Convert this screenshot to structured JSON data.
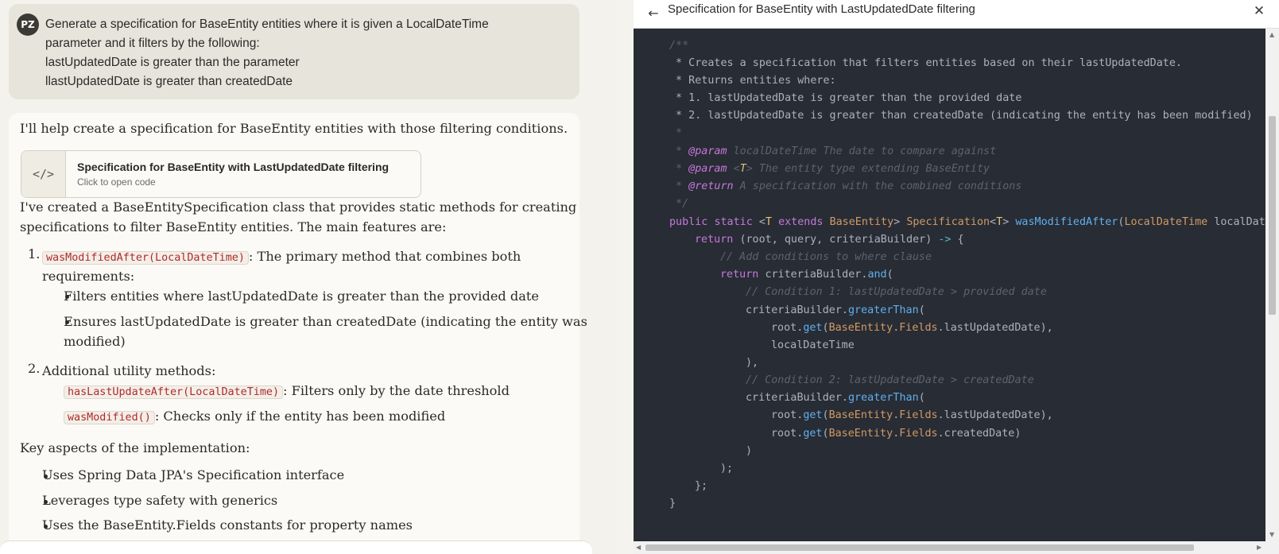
{
  "user_message": {
    "initials": "PZ",
    "lines": [
      "Generate a specification for BaseEntity entities where it is given a LocalDateTime",
      "parameter and it filters by the following:",
      "lastUpdatedDate is greater than the parameter",
      "llastUpdatedDate is greater than createdDate"
    ]
  },
  "assistant": {
    "intro": "I'll help create a specification for BaseEntity entities with those filtering conditions.",
    "artifact": {
      "icon": "</>",
      "title": "Specification for BaseEntity with LastUpdatedDate filtering",
      "subtitle": "Click to open code"
    },
    "para1_line1": "I've created a BaseEntitySpecification class that provides static methods for creating",
    "para1_line2": "specifications to filter BaseEntity entities. The main features are:",
    "item1": {
      "num": "1.",
      "code": "wasModifiedAfter(LocalDateTime)",
      "text1": ": The primary method that combines both",
      "text2": "requirements:",
      "bullets": [
        "Filters entities where lastUpdatedDate is greater than the provided date",
        "Ensures lastUpdatedDate is greater than createdDate (indicating the entity was",
        "modified)"
      ]
    },
    "item2": {
      "num": "2.",
      "text": "Additional utility methods:",
      "b1_code": "hasLastUpdateAfter(LocalDateTime)",
      "b1_text": ": Filters only by the date threshold",
      "b2_code": "wasModified()",
      "b2_text": ": Checks only if the entity has been modified"
    },
    "key_aspects": "Key aspects of the implementation:",
    "aspects": [
      "Uses Spring Data JPA's Specification interface",
      "Leverages type safety with generics",
      "Uses the BaseEntity.Fields constants for property names"
    ]
  },
  "panel": {
    "title": "Specification for BaseEntity with LastUpdatedDate filtering",
    "back_icon": "arrow-left-icon",
    "close_icon": "close-icon"
  },
  "code": {
    "l01": "/**",
    "l02": " * Creates a specification that filters entities based on their lastUpdatedDate.",
    "l03": " * Returns entities where:",
    "l04": " * 1. lastUpdatedDate is greater than the provided date",
    "l05": " * 2. lastUpdatedDate is greater than createdDate (indicating the entity has been modified)",
    "l06": " *",
    "l07a": " * ",
    "l07b": "@param",
    "l07c": " localDateTime The date to compare against",
    "l08a": " * ",
    "l08b": "@param",
    "l08c": " <",
    "l08d": "T",
    "l08e": "> The entity type extending BaseEntity",
    "l09a": " * ",
    "l09b": "@return",
    "l09c": " A specification with the combined conditions",
    "l10": " */",
    "l11_public": "public",
    "l11_static": "static",
    "l11_lt": "<",
    "l11_T": "T",
    "l11_extends": "extends",
    "l11_base": "BaseEntity",
    "l11_gt": ">",
    "l11_spec": "Specification",
    "l11_lt2": "<",
    "l11_T2": "T",
    "l11_gt2": ">",
    "l11_fn": "wasModifiedAfter",
    "l11_paren": "(",
    "l11_ldt": "LocalDateTime",
    "l11_param": "localDateTime",
    "l12_return": "return",
    "l12_args": "(root, query, criteriaBuilder)",
    "l12_arrow": "->",
    "l12_brace": "{",
    "l13": "// Add conditions to where clause",
    "l14_return": "return",
    "l14_cb": "criteriaBuilder.",
    "l14_and": "and",
    "l14_paren": "(",
    "l15": "// Condition 1: lastUpdatedDate > provided date",
    "l16_cb": "criteriaBuilder.",
    "l16_gt": "greaterThan",
    "l16_paren": "(",
    "l17_root": "root.",
    "l17_get": "get",
    "l17_p": "(",
    "l17_be": "BaseEntity",
    "l17_dot": ".",
    "l17_fields": "Fields",
    "l17_rest": ".lastUpdatedDate),",
    "l18": "localDateTime",
    "l19": "),",
    "l20": "// Condition 2: lastUpdatedDate > createdDate",
    "l21_cb": "criteriaBuilder.",
    "l21_gt": "greaterThan",
    "l21_paren": "(",
    "l22_root": "root.",
    "l22_get": "get",
    "l22_p": "(",
    "l22_be": "BaseEntity",
    "l22_dot": ".",
    "l22_fields": "Fields",
    "l22_rest": ".lastUpdatedDate),",
    "l23_root": "root.",
    "l23_get": "get",
    "l23_p": "(",
    "l23_be": "BaseEntity",
    "l23_dot": ".",
    "l23_fields": "Fields",
    "l23_rest": ".createdDate)",
    "l24": ")",
    "l25": ");",
    "l26": "};",
    "l27": "}"
  }
}
